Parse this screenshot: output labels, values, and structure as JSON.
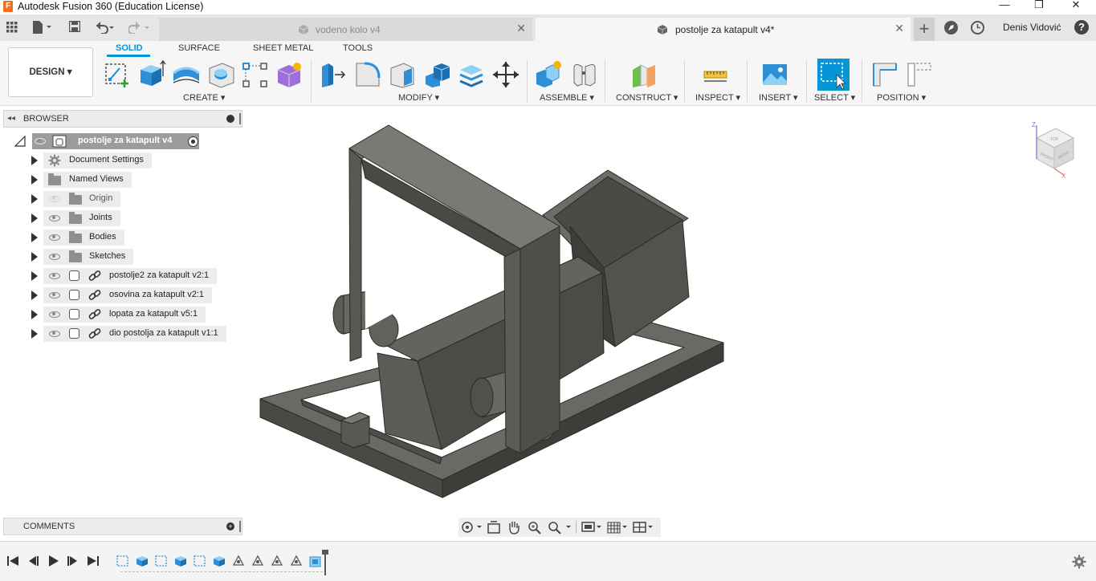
{
  "window": {
    "title": "Autodesk Fusion 360 (Education License)",
    "logo_letter": "F",
    "minimize": "—",
    "maximize": "❐",
    "close": "✕"
  },
  "tabs": [
    {
      "label": "vodeno kolo v4",
      "active": false,
      "close": "✕"
    },
    {
      "label": "postolje za katapult v4*",
      "active": true,
      "close": "✕"
    }
  ],
  "topbar": {
    "add_tab": "+",
    "user_name": "Denis Vidović",
    "help": "?"
  },
  "toolbar": {
    "workspace": "DESIGN ▾",
    "workspace_tabs": [
      "SOLID",
      "SURFACE",
      "SHEET METAL",
      "TOOLS"
    ],
    "active_tab": "SOLID",
    "groups": {
      "create": "CREATE ▾",
      "modify": "MODIFY ▾",
      "assemble": "ASSEMBLE ▾",
      "construct": "CONSTRUCT ▾",
      "inspect": "INSPECT ▾",
      "insert": "INSERT ▾",
      "select": "SELECT ▾",
      "position": "POSITION ▾"
    }
  },
  "browser": {
    "title": "BROWSER",
    "root": "postolje za katapult v4",
    "items": [
      {
        "label": "Document Settings",
        "icon": "gear-icon"
      },
      {
        "label": "Named Views",
        "icon": "folder-icon"
      },
      {
        "label": "Origin",
        "icon": "folder-icon",
        "hidden": true
      },
      {
        "label": "Joints",
        "icon": "folder-icon"
      },
      {
        "label": "Bodies",
        "icon": "folder-icon"
      },
      {
        "label": "Sketches",
        "icon": "folder-icon"
      },
      {
        "label": "postolje2 za katapult v2:1",
        "icon": "component-icon"
      },
      {
        "label": "osovina za katapult v2:1",
        "icon": "component-icon"
      },
      {
        "label": "lopata za katapult v5:1",
        "icon": "component-icon"
      },
      {
        "label": "dio postolja za katapult v1:1",
        "icon": "component-icon"
      }
    ]
  },
  "comments": {
    "title": "COMMENTS"
  },
  "viewcube": {
    "top": "TOP",
    "front": "FRONT",
    "right": "RIGHT",
    "axis_z": "Z",
    "axis_x": "X"
  },
  "colors": {
    "accent": "#0696d7",
    "model": "#5a5852",
    "panel": "#ececec"
  }
}
